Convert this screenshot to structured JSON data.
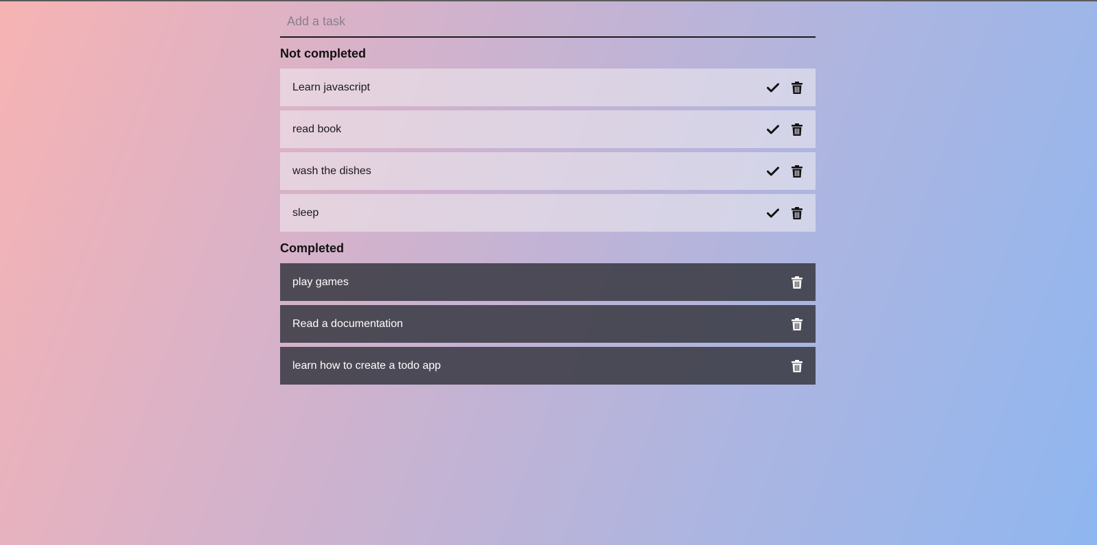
{
  "input": {
    "placeholder": "Add a task",
    "value": ""
  },
  "sections": {
    "not_completed_title": "Not completed",
    "completed_title": "Completed"
  },
  "not_completed": [
    {
      "text": "Learn javascript",
      "icons": [
        "check-icon",
        "trash-icon"
      ]
    },
    {
      "text": "read book",
      "icons": [
        "check-icon",
        "trash-icon"
      ]
    },
    {
      "text": "wash the dishes",
      "icons": [
        "check-icon",
        "trash-icon"
      ]
    },
    {
      "text": "sleep",
      "icons": [
        "check-icon",
        "trash-icon"
      ]
    }
  ],
  "completed": [
    {
      "text": "play games",
      "icons": [
        "trash-icon"
      ]
    },
    {
      "text": "Read a documentation",
      "icons": [
        "trash-icon"
      ]
    },
    {
      "text": "learn how to create a todo app",
      "icons": [
        "trash-icon"
      ]
    }
  ],
  "colors": {
    "gradient_start": "#f7b3b3",
    "gradient_end": "#8fb6f0",
    "completed_item_bg": "#3e3e48",
    "not_completed_item_bg": "#f0ecf0"
  }
}
